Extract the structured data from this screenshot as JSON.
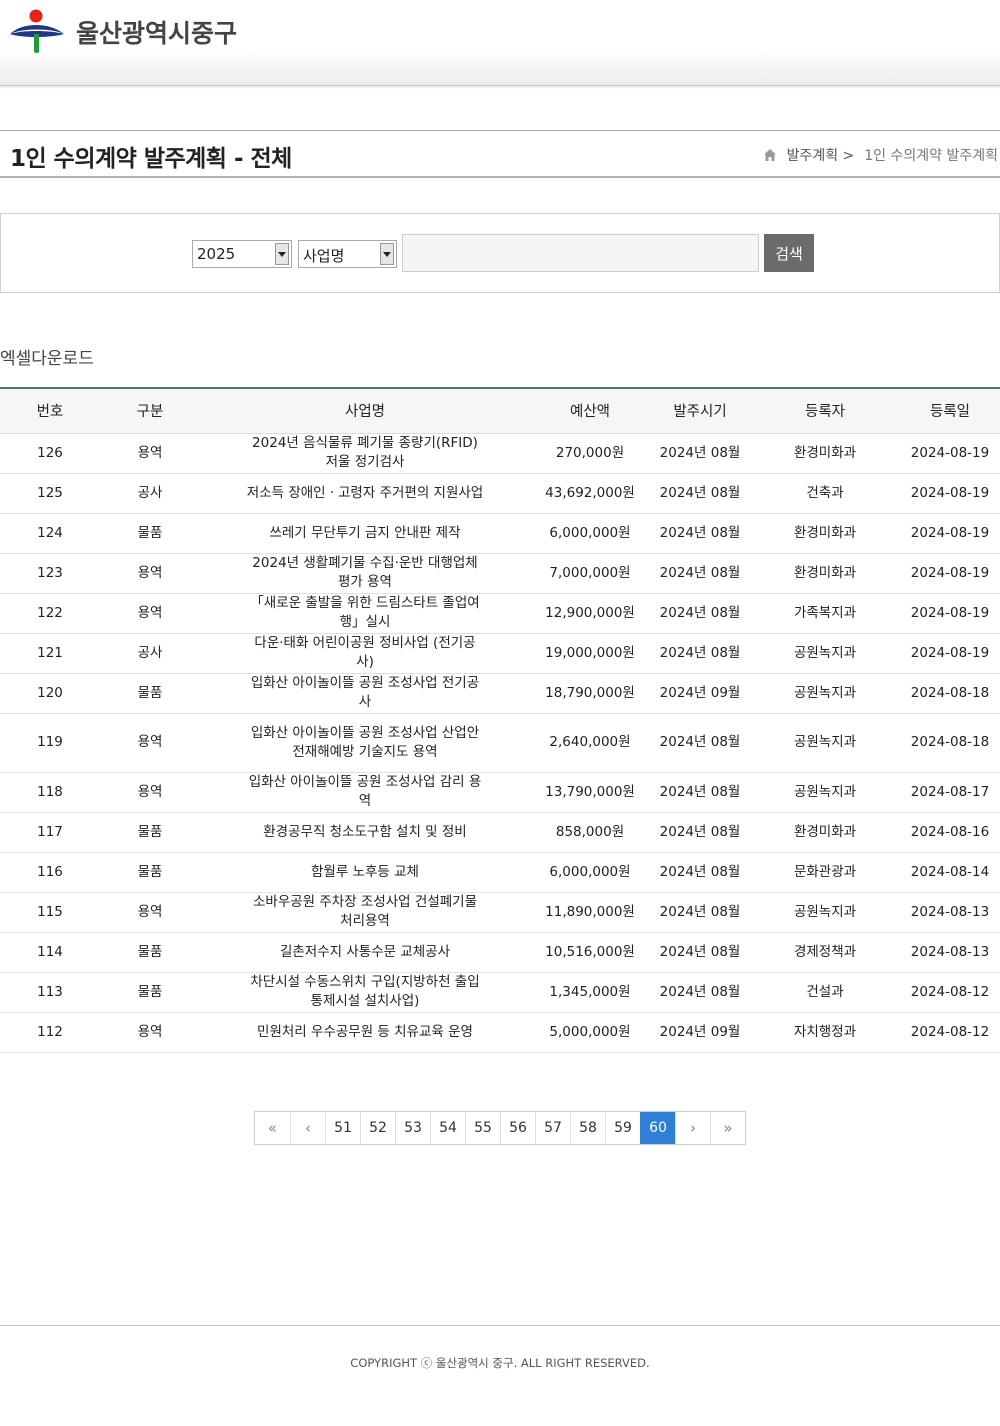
{
  "header": {
    "org_name": "울산광역시중구"
  },
  "page": {
    "title": "1인 수의계약 발주계획 - 전체",
    "breadcrumb": [
      "발주계획 >",
      "1인 수의계약 발주계획"
    ]
  },
  "search": {
    "year_value": "2025",
    "field_value": "사업명",
    "input_value": "",
    "button_label": "검색"
  },
  "excel_download_label": "엑셀다운로드",
  "table": {
    "columns": [
      "번호",
      "구분",
      "사업명",
      "예산액",
      "발주시기",
      "등록자",
      "등록일"
    ],
    "rows": [
      [
        "126",
        "용역",
        "2024년 음식물류 폐기물 종량기(RFID) 저울 정기검사",
        "270,000원",
        "2024년 08월",
        "환경미화과",
        "2024-08-19"
      ],
      [
        "125",
        "공사",
        "저소득 장애인ㆍ고령자 주거편의 지원사업",
        "43,692,000원",
        "2024년 08월",
        "건축과",
        "2024-08-19"
      ],
      [
        "124",
        "물품",
        "쓰레기 무단투기 금지 안내판 제작",
        "6,000,000원",
        "2024년 08월",
        "환경미화과",
        "2024-08-19"
      ],
      [
        "123",
        "용역",
        "2024년 생활폐기물 수집·운반 대행업체 평가 용역",
        "7,000,000원",
        "2024년 08월",
        "환경미화과",
        "2024-08-19"
      ],
      [
        "122",
        "용역",
        "「새로운 출발을 위한 드림스타트 졸업여행」실시",
        "12,900,000원",
        "2024년 08월",
        "가족복지과",
        "2024-08-19"
      ],
      [
        "121",
        "공사",
        "다운·태화 어린이공원 정비사업 (전기공사)",
        "19,000,000원",
        "2024년 08월",
        "공원녹지과",
        "2024-08-19"
      ],
      [
        "120",
        "물품",
        "입화산 아이놀이뜰 공원 조성사업 전기공사",
        "18,790,000원",
        "2024년 09월",
        "공원녹지과",
        "2024-08-18"
      ],
      [
        "119",
        "용역",
        "입화산 아이놀이뜰 공원 조성사업 산업안전재해예방 기술지도 용역",
        "2,640,000원",
        "2024년 08월",
        "공원녹지과",
        "2024-08-18"
      ],
      [
        "118",
        "용역",
        "입화산 아이놀이뜰 공원 조성사업 감리 용역",
        "13,790,000원",
        "2024년 08월",
        "공원녹지과",
        "2024-08-17"
      ],
      [
        "117",
        "물품",
        "환경공무직 청소도구함 설치 및 정비",
        "858,000원",
        "2024년 08월",
        "환경미화과",
        "2024-08-16"
      ],
      [
        "116",
        "물품",
        "함월루 노후등 교체",
        "6,000,000원",
        "2024년 08월",
        "문화관광과",
        "2024-08-14"
      ],
      [
        "115",
        "용역",
        "소바우공원 주차장 조성사업 건설폐기물 처리용역",
        "11,890,000원",
        "2024년 08월",
        "공원녹지과",
        "2024-08-13"
      ],
      [
        "114",
        "물품",
        "길촌저수지 사통수문 교체공사",
        "10,516,000원",
        "2024년 08월",
        "경제정책과",
        "2024-08-13"
      ],
      [
        "113",
        "물품",
        "차단시설 수동스위치 구입(지방하천 출입통제시설 설치사업)",
        "1,345,000원",
        "2024년 08월",
        "건설과",
        "2024-08-12"
      ],
      [
        "112",
        "용역",
        "민원처리 우수공무원 등 치유교육 운영",
        "5,000,000원",
        "2024년 09월",
        "자치행정과",
        "2024-08-12"
      ]
    ]
  },
  "pagination": {
    "first": "«",
    "prev": "‹",
    "pages": [
      "51",
      "52",
      "53",
      "54",
      "55",
      "56",
      "57",
      "58",
      "59",
      "60"
    ],
    "current": "60",
    "next": "›",
    "last": "»"
  },
  "footer": {
    "copyright": "COPYRIGHT ⓒ 울산광역시 중구. ALL RIGHT RESERVED."
  },
  "colors": {
    "accent": "#2f7fd5",
    "table_header_border": "#4a7a6a",
    "search_button": "#6b6b6b"
  }
}
